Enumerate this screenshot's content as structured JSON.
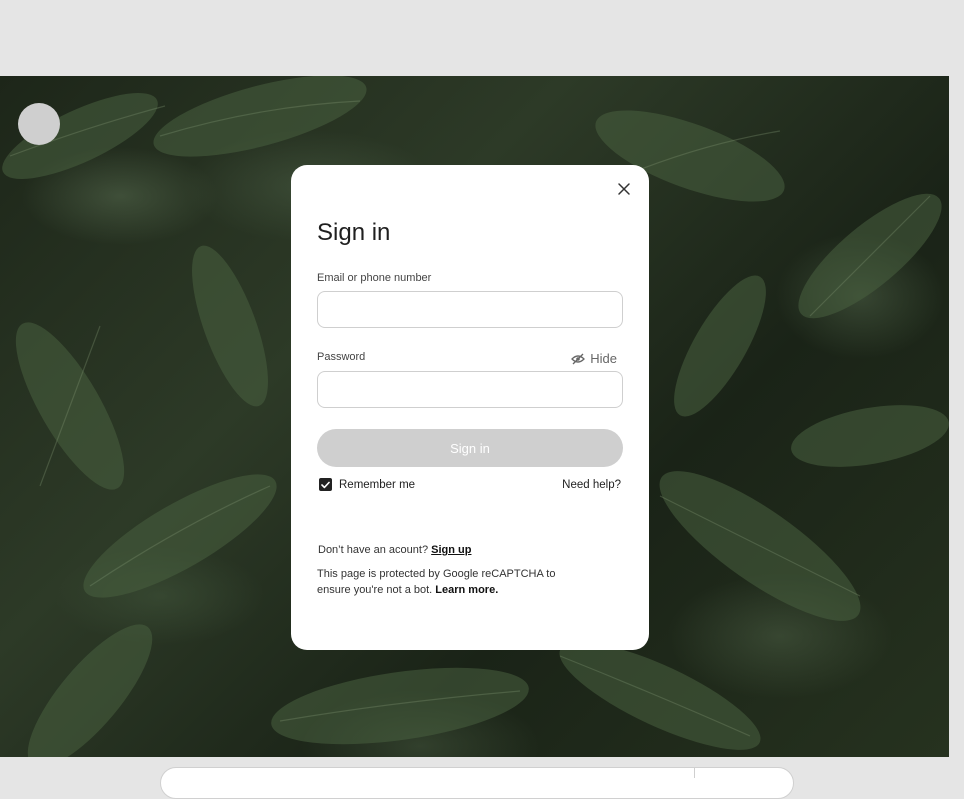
{
  "modal": {
    "title": "Sign in",
    "email_label": "Email or phone number",
    "email_value": "",
    "email_placeholder": "",
    "password_label": "Password",
    "password_value": "",
    "password_placeholder": "",
    "hide_label": "Hide",
    "signin_button": "Sign in",
    "remember_label": "Remember me",
    "remember_checked": true,
    "need_help": "Need help?",
    "no_account_text": "Don’t have an acount?",
    "signup_link": "Sign up",
    "recaptcha_text": "This page is protected by Google reCAPTCHA to ensure you're not a bot.",
    "learn_more": "Learn more."
  },
  "icons": {
    "close": "close-icon",
    "hide": "eye-slash-icon",
    "checkbox": "checkmark-icon"
  },
  "colors": {
    "modal_bg": "#ffffff",
    "button_disabled": "#cfcfcf",
    "page_bg": "#e5e5e5",
    "foliage": "#2d3a27"
  }
}
